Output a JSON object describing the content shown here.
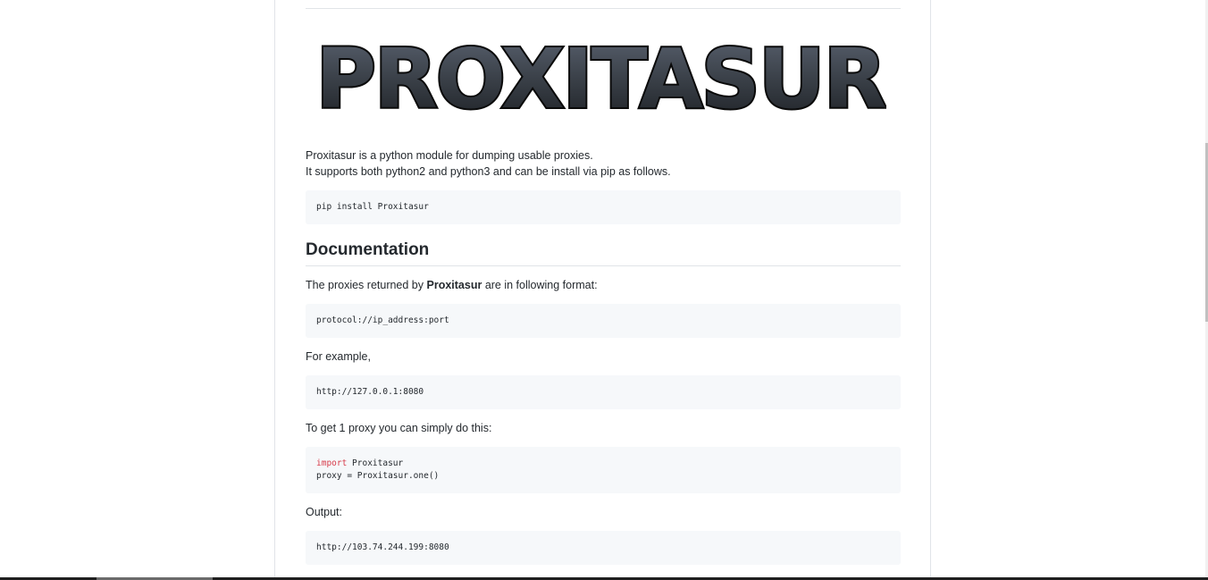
{
  "logo": {
    "text": "PROXITASUR"
  },
  "intro": {
    "line1": "Proxitasur is a python module for dumping usable proxies.",
    "line2": "It supports both python2 and python3 and can be install via pip as follows."
  },
  "install_code": "pip install Proxitasur",
  "documentation": {
    "heading": "Documentation",
    "format_prefix": "The proxies returned by ",
    "format_bold": "Proxitasur",
    "format_suffix": " are in following format:",
    "format_code": "protocol://ip_address:port",
    "example_label": "For example,",
    "example_code": "http://127.0.0.1:8080",
    "get_one_label": "To get 1 proxy you can simply do this:",
    "get_one_code": {
      "keyword": "import",
      "line1_rest": " Proxitasur",
      "line2": "proxy = Proxitasur.one()"
    },
    "output_label": "Output:",
    "output_code": "http://103.74.244.199:8080"
  },
  "colors": {
    "keyword": "#d73a49",
    "code_bg": "#f6f8fa",
    "text": "#24292e",
    "border": "#e1e4e8"
  }
}
